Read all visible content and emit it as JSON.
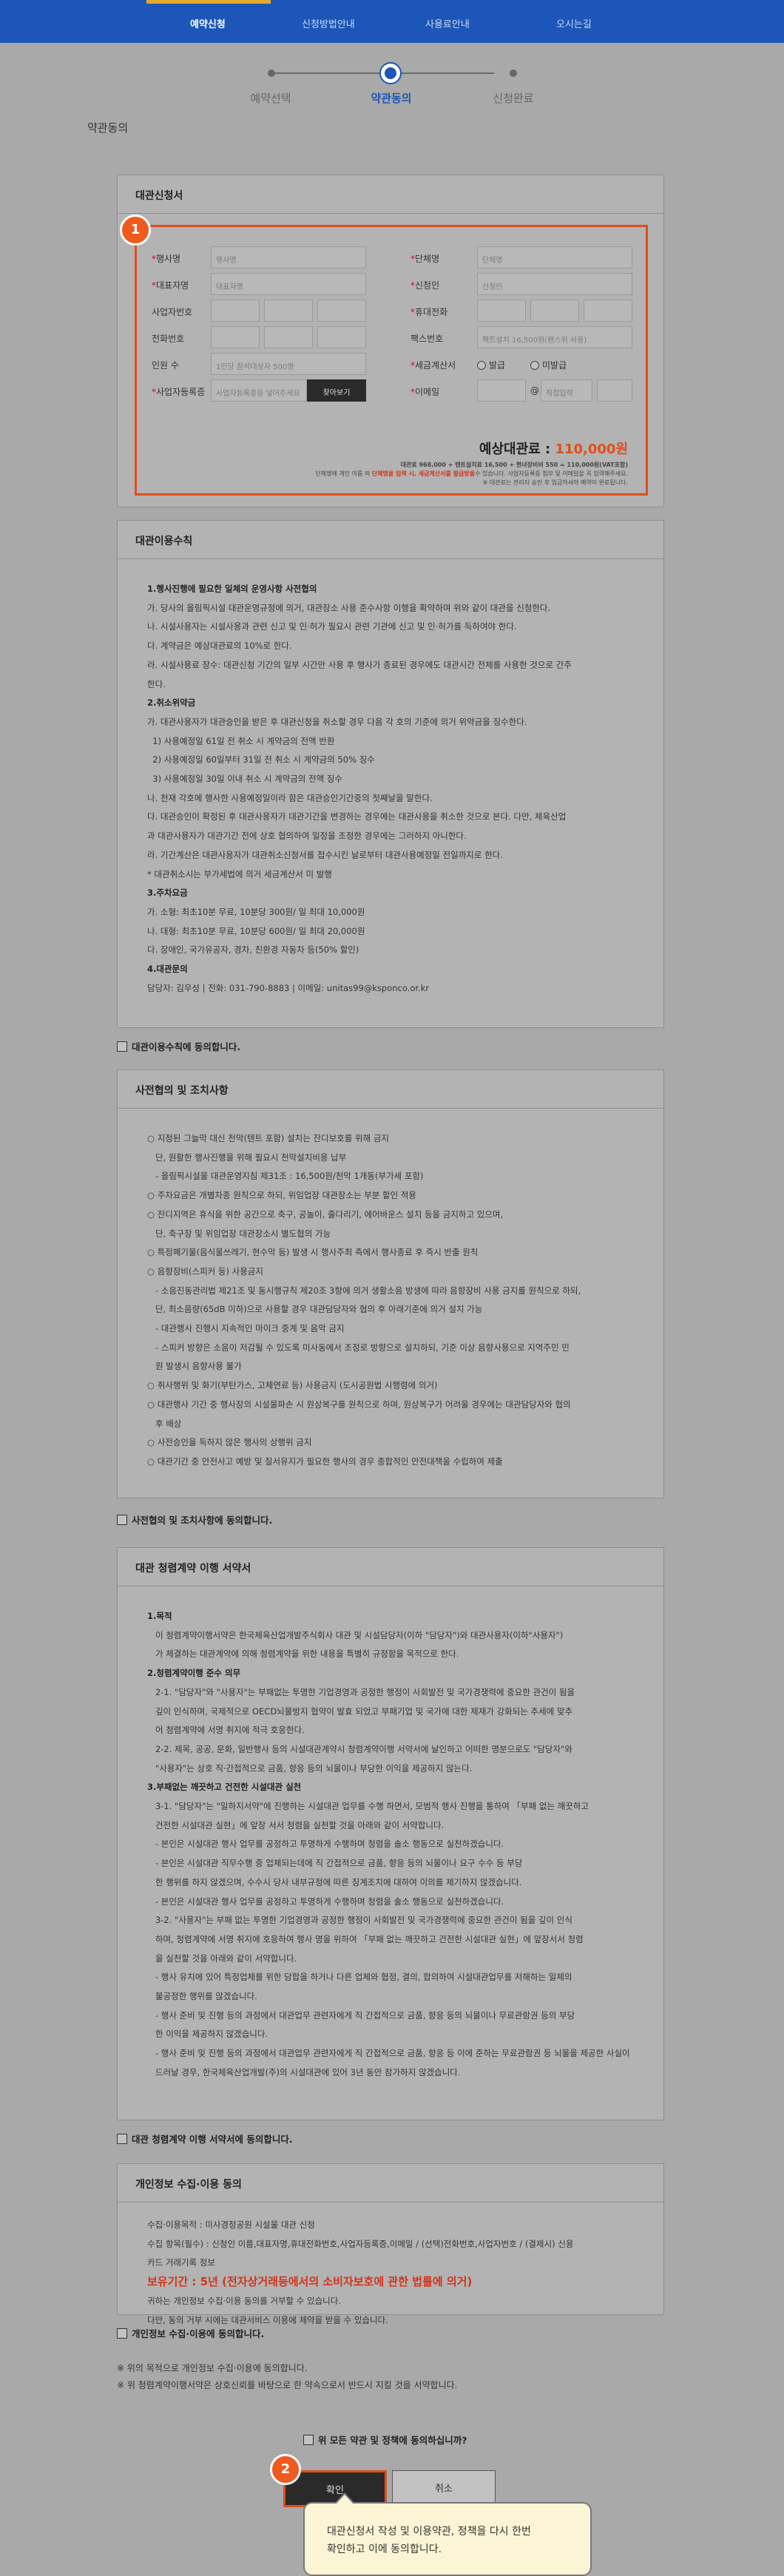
{
  "nav": {
    "items": [
      "예약신청",
      "신청방법안내",
      "사용료안내",
      "오시는길"
    ]
  },
  "steps": [
    "예약선택",
    "약관동의",
    "신청완료"
  ],
  "page_title": "약관동의",
  "application": {
    "title": "대관신청서",
    "badge": "1",
    "fields": {
      "name_label": "행사명",
      "name_ph": "행사명",
      "org_label": "단체명",
      "org_ph": "단체명",
      "rep_label": "대표자명",
      "rep_ph": "대표자명",
      "applicant_label": "신청인",
      "applicant_ph": "신청인",
      "biz_label": "사업자번호",
      "mobile_label": "휴대전화",
      "phone_label": "전화번호",
      "fax_label": "팩스번호",
      "fax_ph": "팩트설치 16,500원(펜스위 사용)",
      "people_label": "인원 수",
      "people_ph": "1인당 참석대상자 500명",
      "tax_label": "세금계산서",
      "tax_opt1": "발급",
      "tax_opt2": "미발급",
      "reg_label": "사업자등록증",
      "reg_ph": "사업자등록증을 넣어주세요",
      "find_btn": "찾아보기",
      "email_label": "이메일",
      "email_at": "@",
      "email_domain": "직접입력"
    },
    "fee_label": "예상대관료 :",
    "fee_value": "110,000원",
    "fee_detail": "대관료 968,000 + 텐트설치료 16,500 + 현녀장비비 550 = 110,000원(VAT포함)",
    "fee_note1_a": "단체명에 개인 이름 외 ",
    "fee_note1_red": "단체명을 입력 시, 세금계산서를 발급받을",
    "fee_note1_b": "수 있습니다. 사업자등록증 첨부 및 이메일을 꼭 입력해주세요.",
    "fee_note2": "※ 대관료는 관리자 승인 후 입금하셔야 예약이 완료됩니다."
  },
  "rules": {
    "title": "대관이용수칙",
    "lines": [
      {
        "t": "1.행사진행에 필요한 일체의 운영사항 사전협의",
        "h": true
      },
      {
        "t": "가. 당사의 올림픽시설 대관운영규정에 의거, 대관장소 사용 준수사항 이행을 확약하며 위와 같이 대관을 신청한다."
      },
      {
        "t": "나. 시설사용자는 시설사용과 관련 신고 및 인·허가 필요시 관련 기관에 신고 및 인·허가를 득하여야 한다."
      },
      {
        "t": "다. 계약금은 예상대관료의 10%로 한다."
      },
      {
        "t": "라. 시설사용료 장수: 대관신청 기간의 일부 시간만 사용 후 행사가 종료된 경우에도 대관시간 전체를 사용한 것으로 간주"
      },
      {
        "t": "한다."
      },
      {
        "t": "2.취소위약금",
        "h": true
      },
      {
        "t": "가. 대관사용자가 대관승인을 받은 후 대관신청을 취소할 경우 다음 각 호의 기준에 의거 위약금을 징수한다."
      },
      {
        "t": "  1) 사용예정일 61일 전 취소 시 계약금의 전액 반환"
      },
      {
        "t": "  2) 사용예정일 60일부터 31일 전 취소 시 계약금의 50% 징수"
      },
      {
        "t": "  3) 사용예정일 30일 이내 취소 시 계약금의 전액 징수"
      },
      {
        "t": "나. 천재 각호에 행사한 사용예정일이라 함은 대관승인기간중의 첫째날을 말한다."
      },
      {
        "t": "다. 대관승인이 확정된 후 대관사용자가 대관기간을 변경하는 경우에는 대관사용을 취소한 것으로 본다. 다만, 체육산업"
      },
      {
        "t": "과 대관사용자가 대관기간 전에 상호 협의하여 일정을 조정한 경우에는 그러하지 아니한다."
      },
      {
        "t": "라. 기간계산은 대관사용자가 대관취소신청서를 접수시킨 날로부터 대관사용예정일 전일까지로 한다."
      },
      {
        "t": "* 대관취소시는 부가세법에 의거 세금계산서 미 발행"
      },
      {
        "t": "3.주차요금",
        "h": true
      },
      {
        "t": "가. 소형: 최초10분 무료, 10분당 300원/ 일 최대 10,000원"
      },
      {
        "t": "나. 대형: 최초10분 무료, 10분당 600원/ 일 최대 20,000원"
      },
      {
        "t": "다. 장애인, 국가유공자, 경차, 친환경 자동차 등(50% 할인)"
      },
      {
        "t": "4.대관문의",
        "h": true
      },
      {
        "t": "담당자: 김우성 | 전화: 031-790-8883 | 이메일: unitas99@ksponco.or.kr"
      }
    ],
    "agree": "대관이용수칙에 동의합니다."
  },
  "prior": {
    "title": "사전협의 및 조치사항",
    "lines": [
      "○ 지정된 그늘막 대신 천막(텐트 포함) 설치는 잔디보호를 위해 금지",
      "   단, 원활한 행사진행을 위해 필요시 천막설치비용 납부",
      "   - 올림픽시설물 대관운영지침 제31조 : 16,500원/천막 1개동(부가세 포함)",
      "○ 주차요금은 개별차종 원칙으로 하되, 위임업장 대관장소는 부분 할인 적용",
      "○ 잔디지역은 휴식을 위한 공간으로 축구, 공놀이, 줄다리기, 에어바운스 설치 등을 금지하고 있으며,",
      "   단, 축구장 및 위임업장 대관장소시 별도협의 가능",
      "○ 특정폐기물(음식물쓰레기, 현수막 등) 발생 시 행사주최 측에서 행사종료 후 즉시 반출 원칙",
      "○ 음향장비(스피커 등) 사용금지",
      "   - 소음진동관리법 제21조 및 동시행규칙 제20조 3항에 의거 생활소음 방생에 따라 음향장비 사용 금지를 원칙으로 하되,",
      "   단, 최소음량(65dB 이하)으로 사용할 경우 대관담당자와 협의 후 아래기준에 의거 설치 가능",
      "   - 대관행사 진행시 지속적인 마이크 중계 및 음악 금지",
      "   - 스피커 방향은 소음이 저감될 수 있도록 미사동에서 조정로 방향으로 설치하되, 기준 이상 음향사용으로 지역주민 민",
      "   원 발생시 음향사용 불가",
      "○ 취사행위 및 화기(부탄가스, 고체연료 등) 사용금지 (도시공원법 시행령에 의거)",
      "○ 대관행사 기간 중 행사장의 시설물파손 시 원상복구를 원칙으로 하며, 원상복구가 어려울 경우에는 대관담당자와 협의",
      "   후 배상",
      "○ 사전승인을 득하지 않은 행사의 상행위 금지",
      "○ 대관기간 중 안전사고 예방 및 질서유지가 필요한 행사의 경우 종합적인 안전대책을 수립하여 제출"
    ],
    "agree": "사전협의 및 조치사항에 동의합니다."
  },
  "integrity": {
    "title": "대관 청렴계약 이행 서약서",
    "lines": [
      {
        "t": "1.목적",
        "h": true
      },
      {
        "t": "   이 청렴계약이행서약은 한국체육산업개발주식회사 대관 및 시설담당자(이하 \"담당자\")와 대관사용자(이하\"사용자\")"
      },
      {
        "t": "   가 체결하는 대관계약에 의해 청렴계약을 위한 내용을 특별히 규정함을 목적으로 한다."
      },
      {
        "t": "2.청렴계약이행 준수 의무",
        "h": true
      },
      {
        "t": "   2-1. \"담당자\"와 \"사용자\"는 부패없는 투명한 기업경영과 공정한 행정이 사회발전 및 국가경쟁력에 중요한 관건이 됨을"
      },
      {
        "t": "   깊이 인식하며, 국제적으로 OECD뇌물방지 협약이 발효 되었고 부패기업 및 국가에 대한 제재가 강화되는 추세에 맞추"
      },
      {
        "t": "   어 청렴계약에 서명 취지에 적극 호응한다."
      },
      {
        "t": "   2-2. 제목, 공공, 문화, 일반행사 등의 시설대관계약시 청렴계약이행 서약서에 날인하고 어떠한 명분으로도 \"담당자\"와"
      },
      {
        "t": "   \"사용자\"는 상호 직·간접적으로 금품, 향응 등의 뇌물이나 부당한 이익을 제공하지 않는다."
      },
      {
        "t": "3.부패없는 깨끗하고 건전한 시설대관 실천",
        "h": true
      },
      {
        "t": "   3-1. \"담당자\"는 \"일하지서약\"에 진행하는 시설대관 업무를 수행 하면서, 모범적 행사 진행을 통하여 「부패 없는 깨끗하고"
      },
      {
        "t": "   건전한 시설대관 실현」에 앞장 서서 청렴을 실천할 것을 아래와 같이 서약합니다."
      },
      {
        "t": "   - 본인은 시설대관 행사 업무를 공정하고 투명하게 수행하며 청렴을 솔소 행동으로 실천하겠습니다."
      },
      {
        "t": "   - 본인은 시설대관 직무수행 중 업체되는데에 직 간접적으로 금품, 향응 등의 뇌물이나 요구 수수 등 부당"
      },
      {
        "t": "   한 행위를 하지 않겠으며, 수수시 당사 내부규정에 따른 징계조치에 대하여 이의를 제기하지 않겠습니다."
      },
      {
        "t": "   - 본인은 시설대관 행사 업무를 공정하고 투명하게 수행하며 청렴을 솔소 행동으로 실천하겠습니다."
      },
      {
        "t": "   3-2. \"사용자\"는 부패 없는 투명한 기업경영과 공정한 행정이 사회발전 및 국가경쟁력에 중요한 관건이 됨을 깊이 인식"
      },
      {
        "t": "   하며, 청렴계약에 서명 취지에 호응하여 행사 명을 위하여 「부패 없는 깨끗하고 건전한 시설대관 실현」에 앞장서서 청렴"
      },
      {
        "t": "   을 실천할 것을 아래와 같이 서약합니다."
      },
      {
        "t": "   - 행사 유치에 있어 특정업체를 위한 담합을 하거나 다른 업체와 협정, 결의, 합의하여 시설대관업무를 저해하는 일체의"
      },
      {
        "t": "   불공정한 행위를 않겠습니다."
      },
      {
        "t": "   - 행사 준비 및 진행 등의 과정에서 대관업무 관련자에게 직 간접적으로 금품, 향응 등의 뇌물이나 무료관람권 등의 부당"
      },
      {
        "t": "   한 이익을 제공하지 않겠습니다."
      },
      {
        "t": "   - 행사 준비 및 진행 등의 과정에서 대관업무 관련자에게 직 간접적으로 금품, 향응 등 이에 준하는 무료관람권 등 뇌물을 제공한 사실이"
      },
      {
        "t": "   드러날 경우, 한국체육산업개발(주)의 시설대관에 있어 3년 동안 참가하지 않겠습니다."
      }
    ],
    "agree": "대관 청렴계약 이행 서약서에 동의합니다."
  },
  "privacy": {
    "title": "개인정보 수집·이용 동의",
    "l1": "수집·이용목적 : 미사경정공원 시설물 대관 신청",
    "l2": "수집 항목(필수) : 신청인 이름,대표자명,휴대전화번호,사업자등록증,이메일 / (선택)전화번호,사업자번호 / (결제시) 신용",
    "l3": "카드 거래기록 정보",
    "retention": "보유기간 : 5년 (전자상거래등에서의 소비자보호에 관한 법률에 의거)",
    "l4": "귀하는 개인정보 수집·이용 동의를 거부할 수 있습니다.",
    "l5": "다만, 동의 거부 시에는 대관서비스 이용에 제약을 받을 수 있습니다.",
    "agree": "개인정보 수집·이용에 동의합니다."
  },
  "notes": [
    "※ 위의 목적으로 개인정보 수집·이용에 동의합니다.",
    "※ 위 청렴계약이행서약은 상호신뢰를 바탕으로 한 약속으로서 반드시 지킬 것을 서약합니다."
  ],
  "final_agree": "위 모든 약관 및 정책에 동의하십니까?",
  "buttons": {
    "confirm": "확인",
    "cancel": "취소",
    "badge": "2"
  },
  "tooltip": {
    "l1": "대관신청서 작성 및 이용약관, 정책을 다시 한번",
    "l2": "확인하고 이에 동의합니다."
  }
}
